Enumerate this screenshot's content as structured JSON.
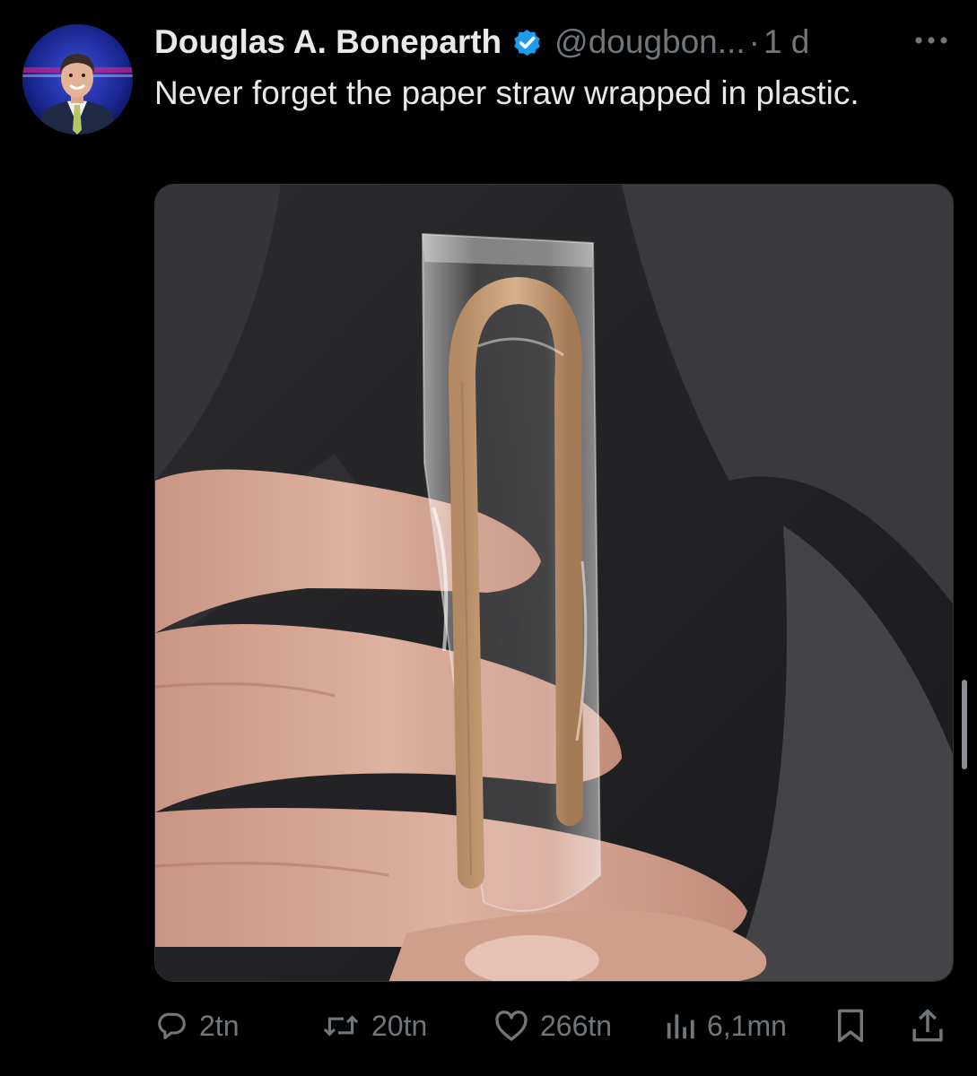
{
  "tweet": {
    "author": {
      "display_name": "Douglas A. Boneparth",
      "handle": "@dougbon...",
      "verified": true,
      "avatar_icon": "avatar-photo"
    },
    "separator": "·",
    "time": "1 d",
    "more_icon": "more-horizontal-icon",
    "text": "Never forget the paper straw wrapped in plastic.",
    "media": {
      "type": "photo",
      "icon": "photo-straw-in-plastic"
    },
    "actions": {
      "reply": {
        "icon": "reply-icon",
        "count": "2tn"
      },
      "retweet": {
        "icon": "retweet-icon",
        "count": "20tn"
      },
      "like": {
        "icon": "heart-icon",
        "count": "266tn"
      },
      "views": {
        "icon": "views-icon",
        "count": "6,1mn"
      },
      "bookmark": {
        "icon": "bookmark-icon"
      },
      "share": {
        "icon": "share-icon"
      }
    }
  },
  "colors": {
    "background": "#000000",
    "text_primary": "#e7e9ea",
    "text_secondary": "#71767b",
    "verified_blue": "#1d9bf0"
  }
}
